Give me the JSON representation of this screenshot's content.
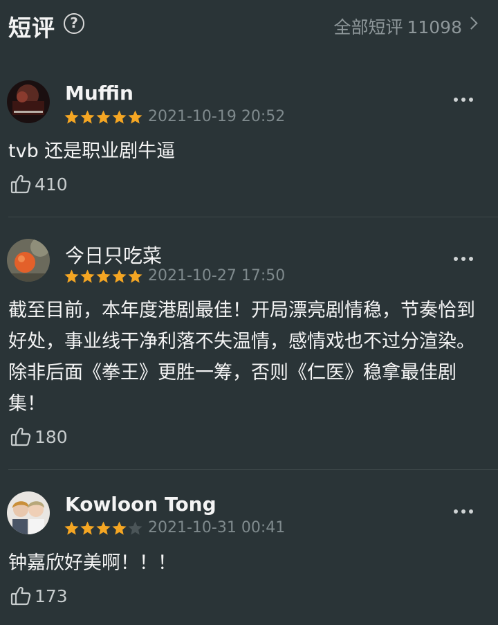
{
  "header": {
    "title": "短评",
    "help_icon": "question-circle-icon",
    "all_label": "全部短评",
    "all_count": "11098"
  },
  "reviews": [
    {
      "name": "Muffin",
      "rating": 5,
      "date": "2021-10-19 20:52",
      "content": "tvb 还是职业剧牛逼",
      "likes": "410"
    },
    {
      "name": "今日只吃菜",
      "rating": 5,
      "date": "2021-10-27 17:50",
      "content": "截至目前，本年度港剧最佳！开局漂亮剧情稳，节奏恰到好处，事业线干净利落不失温情，感情戏也不过分渲染。除非后面《拳王》更胜一筹，否则《仁医》稳拿最佳剧集！",
      "likes": "180"
    },
    {
      "name": "Kowloon Tong",
      "rating": 4,
      "date": "2021-10-31 00:41",
      "content": "钟嘉欣好美啊！！！",
      "likes": "173"
    }
  ],
  "colors": {
    "background": "#2a3437",
    "star": "#f5a623",
    "star_empty": "#4b5558"
  }
}
